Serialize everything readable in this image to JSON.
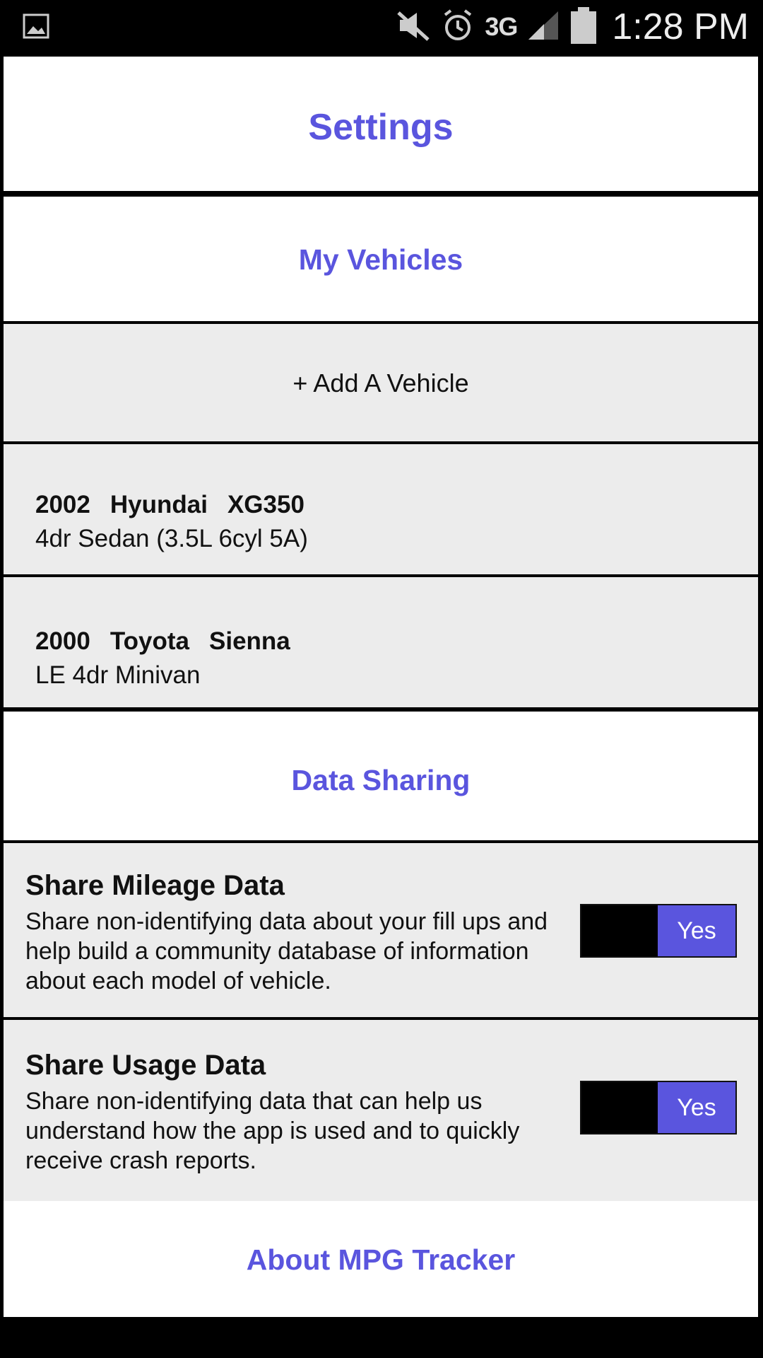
{
  "status_bar": {
    "time": "1:28 PM",
    "network": "3G",
    "icons": [
      "gallery-icon",
      "mute-icon",
      "alarm-icon",
      "signal-icon",
      "battery-icon"
    ]
  },
  "settings": {
    "title": "Settings",
    "my_vehicles_header": "My Vehicles",
    "add_vehicle_label": "+ Add A Vehicle",
    "vehicles": [
      {
        "year": "2002",
        "make": "Hyundai",
        "model": "XG350",
        "trim": "4dr Sedan (3.5L 6cyl 5A)"
      },
      {
        "year": "2000",
        "make": "Toyota",
        "model": "Sienna",
        "trim": "LE 4dr Minivan"
      }
    ],
    "data_sharing_header": "Data Sharing",
    "sharing": [
      {
        "title": "Share Mileage Data",
        "description": "Share non-identifying data about your fill ups and help build a community database of information about each model of vehicle.",
        "toggle_label": "Yes"
      },
      {
        "title": "Share Usage Data",
        "description": "Share non-identifying data that can help us understand how the app is used and to quickly receive crash reports.",
        "toggle_label": "Yes"
      }
    ],
    "about_label": "About MPG Tracker"
  },
  "colors": {
    "accent": "#5a55de",
    "row_background": "#ececec",
    "section_background": "#ffffff"
  }
}
